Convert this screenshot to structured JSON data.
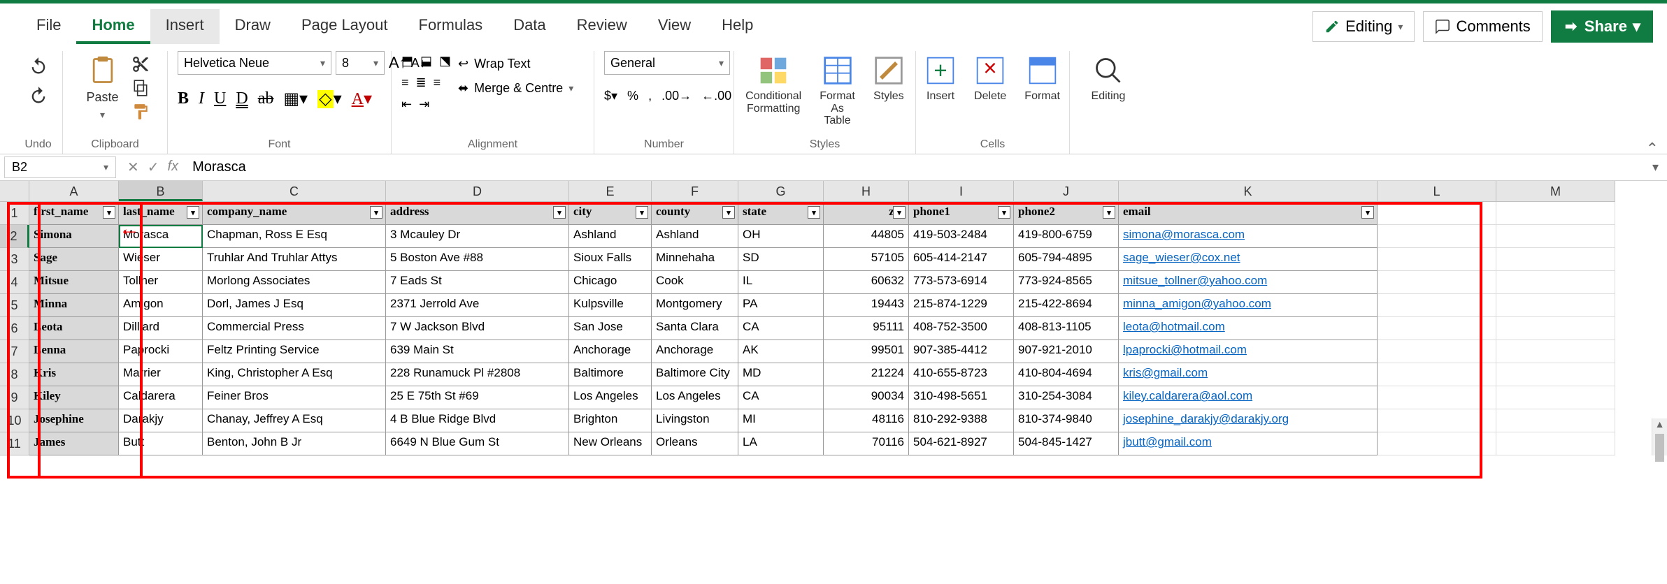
{
  "menus": [
    "File",
    "Home",
    "Insert",
    "Draw",
    "Page Layout",
    "Formulas",
    "Data",
    "Review",
    "View",
    "Help"
  ],
  "active_menu": "Home",
  "hover_menu": "Insert",
  "editing_mode": "Editing",
  "comments_label": "Comments",
  "share_label": "Share",
  "ribbon": {
    "undo_label": "Undo",
    "clipboard_label": "Clipboard",
    "paste_label": "Paste",
    "font_label": "Font",
    "font_name": "Helvetica Neue",
    "font_size": "8",
    "alignment_label": "Alignment",
    "wrap_text": "Wrap Text",
    "merge_centre": "Merge & Centre",
    "number_label": "Number",
    "number_format": "General",
    "styles_label": "Styles",
    "cond_fmt": "Conditional Formatting",
    "fmt_table": "Format As Table",
    "styles_btn": "Styles",
    "cells_label": "Cells",
    "insert_btn": "Insert",
    "delete_btn": "Delete",
    "format_btn": "Format",
    "editing_label": "Editing"
  },
  "name_box": "B2",
  "formula_value": "Morasca",
  "columns": [
    "A",
    "B",
    "C",
    "D",
    "E",
    "F",
    "G",
    "H",
    "I",
    "J",
    "K",
    "L",
    "M"
  ],
  "selected_col": "B",
  "selected_row": 2,
  "headers": [
    "first_name",
    "last_name",
    "company_name",
    "address",
    "city",
    "county",
    "state",
    "zip",
    "phone1",
    "phone2",
    "email"
  ],
  "rows": [
    {
      "n": 2,
      "first_name": "Simona",
      "last_name": "Morasca",
      "company_name": "Chapman, Ross E Esq",
      "address": "3 Mcauley Dr",
      "city": "Ashland",
      "county": "Ashland",
      "state": "OH",
      "zip": "44805",
      "phone1": "419-503-2484",
      "phone2": "419-800-6759",
      "email": "simona@morasca.com"
    },
    {
      "n": 3,
      "first_name": "Sage",
      "last_name": "Wieser",
      "company_name": "Truhlar And Truhlar Attys",
      "address": "5 Boston Ave #88",
      "city": "Sioux Falls",
      "county": "Minnehaha",
      "state": "SD",
      "zip": "57105",
      "phone1": "605-414-2147",
      "phone2": "605-794-4895",
      "email": "sage_wieser@cox.net"
    },
    {
      "n": 4,
      "first_name": "Mitsue",
      "last_name": "Tollner",
      "company_name": "Morlong Associates",
      "address": "7 Eads St",
      "city": "Chicago",
      "county": "Cook",
      "state": "IL",
      "zip": "60632",
      "phone1": "773-573-6914",
      "phone2": "773-924-8565",
      "email": "mitsue_tollner@yahoo.com"
    },
    {
      "n": 5,
      "first_name": "Minna",
      "last_name": "Amigon",
      "company_name": "Dorl, James J Esq",
      "address": "2371 Jerrold Ave",
      "city": "Kulpsville",
      "county": "Montgomery",
      "state": "PA",
      "zip": "19443",
      "phone1": "215-874-1229",
      "phone2": "215-422-8694",
      "email": "minna_amigon@yahoo.com"
    },
    {
      "n": 6,
      "first_name": "Leota",
      "last_name": "Dilliard",
      "company_name": "Commercial Press",
      "address": "7 W Jackson Blvd",
      "city": "San Jose",
      "county": "Santa Clara",
      "state": "CA",
      "zip": "95111",
      "phone1": "408-752-3500",
      "phone2": "408-813-1105",
      "email": "leota@hotmail.com"
    },
    {
      "n": 7,
      "first_name": "Lenna",
      "last_name": "Paprocki",
      "company_name": "Feltz Printing Service",
      "address": "639 Main St",
      "city": "Anchorage",
      "county": "Anchorage",
      "state": "AK",
      "zip": "99501",
      "phone1": "907-385-4412",
      "phone2": "907-921-2010",
      "email": "lpaprocki@hotmail.com"
    },
    {
      "n": 8,
      "first_name": "Kris",
      "last_name": "Marrier",
      "company_name": "King, Christopher A Esq",
      "address": "228 Runamuck Pl #2808",
      "city": "Baltimore",
      "county": "Baltimore City",
      "state": "MD",
      "zip": "21224",
      "phone1": "410-655-8723",
      "phone2": "410-804-4694",
      "email": "kris@gmail.com"
    },
    {
      "n": 9,
      "first_name": "Kiley",
      "last_name": "Caldarera",
      "company_name": "Feiner Bros",
      "address": "25 E 75th St #69",
      "city": "Los Angeles",
      "county": "Los Angeles",
      "state": "CA",
      "zip": "90034",
      "phone1": "310-498-5651",
      "phone2": "310-254-3084",
      "email": "kiley.caldarera@aol.com"
    },
    {
      "n": 10,
      "first_name": "Josephine",
      "last_name": "Darakjy",
      "company_name": "Chanay, Jeffrey A Esq",
      "address": "4 B Blue Ridge Blvd",
      "city": "Brighton",
      "county": "Livingston",
      "state": "MI",
      "zip": "48116",
      "phone1": "810-292-9388",
      "phone2": "810-374-9840",
      "email": "josephine_darakjy@darakjy.org"
    },
    {
      "n": 11,
      "first_name": "James",
      "last_name": "Butt",
      "company_name": "Benton, John B Jr",
      "address": "6649 N Blue Gum St",
      "city": "New Orleans",
      "county": "Orleans",
      "state": "LA",
      "zip": "70116",
      "phone1": "504-621-8927",
      "phone2": "504-845-1427",
      "email": "jbutt@gmail.com"
    }
  ]
}
